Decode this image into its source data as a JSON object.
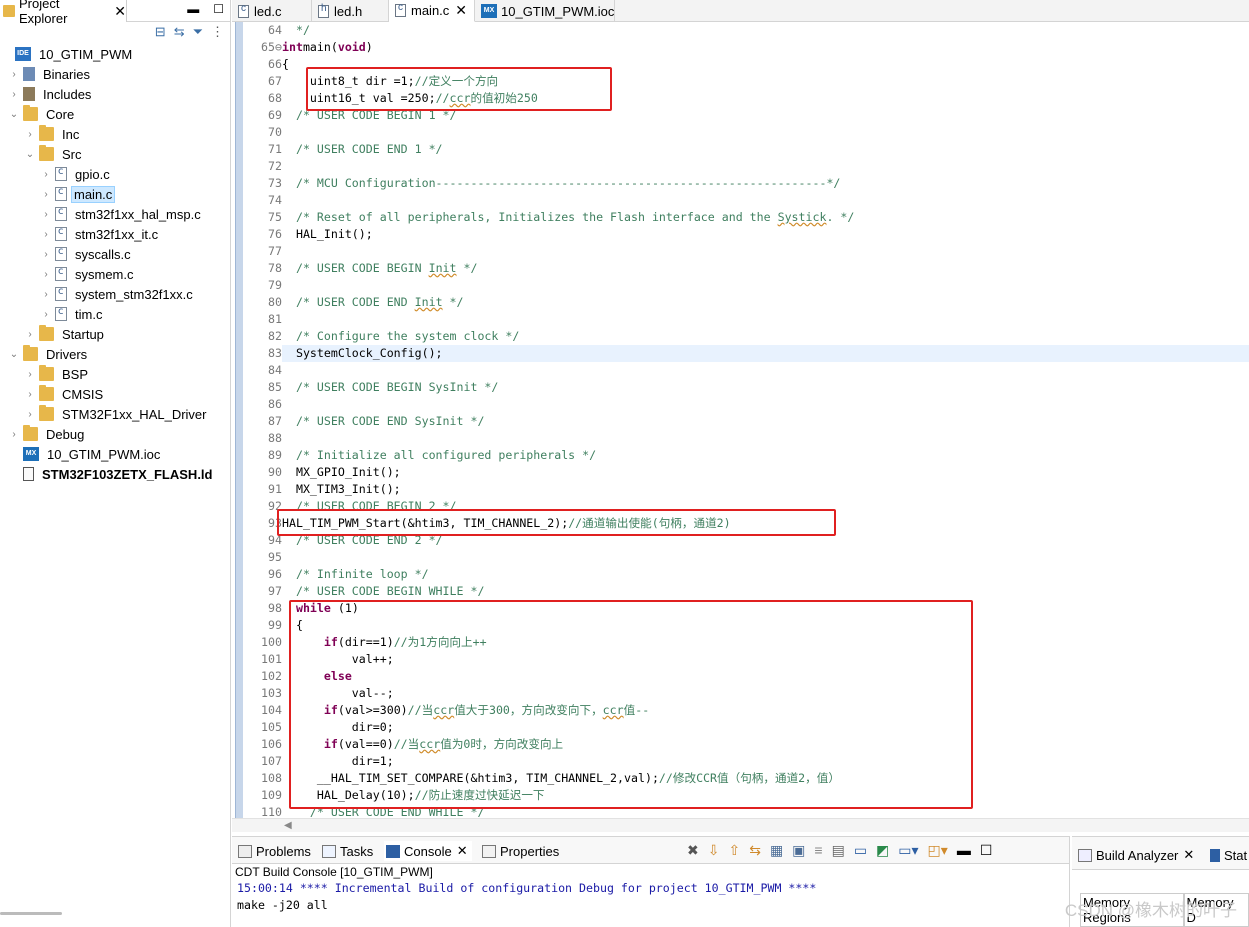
{
  "project_explorer": {
    "title": "Project Explorer",
    "items": [
      {
        "label": "10_GTIM_PWM",
        "icon": "project-icon",
        "chev": "",
        "level": 0
      },
      {
        "label": "Binaries",
        "icon": "binaries-icon",
        "chev": "›",
        "level": 1
      },
      {
        "label": "Includes",
        "icon": "includes-icon",
        "chev": "›",
        "level": 1
      },
      {
        "label": "Core",
        "icon": "folder-icon",
        "chev": "⌄",
        "level": 1
      },
      {
        "label": "Inc",
        "icon": "folder-icon",
        "chev": "›",
        "level": 2
      },
      {
        "label": "Src",
        "icon": "folder-icon",
        "chev": "⌄",
        "level": 2
      },
      {
        "label": "gpio.c",
        "icon": "c-file-icon",
        "chev": "›",
        "level": 3
      },
      {
        "label": "main.c",
        "icon": "c-file-icon",
        "chev": "›",
        "level": 3,
        "selected": true
      },
      {
        "label": "stm32f1xx_hal_msp.c",
        "icon": "c-file-icon",
        "chev": "›",
        "level": 3
      },
      {
        "label": "stm32f1xx_it.c",
        "icon": "c-file-icon",
        "chev": "›",
        "level": 3
      },
      {
        "label": "syscalls.c",
        "icon": "c-file-icon",
        "chev": "›",
        "level": 3
      },
      {
        "label": "sysmem.c",
        "icon": "c-file-icon",
        "chev": "›",
        "level": 3
      },
      {
        "label": "system_stm32f1xx.c",
        "icon": "c-file-icon",
        "chev": "›",
        "level": 3
      },
      {
        "label": "tim.c",
        "icon": "c-file-icon",
        "chev": "›",
        "level": 3
      },
      {
        "label": "Startup",
        "icon": "folder-icon",
        "chev": "›",
        "level": 2
      },
      {
        "label": "Drivers",
        "icon": "folder-icon",
        "chev": "⌄",
        "level": 1
      },
      {
        "label": "BSP",
        "icon": "folder-icon",
        "chev": "›",
        "level": 2
      },
      {
        "label": "CMSIS",
        "icon": "folder-icon",
        "chev": "›",
        "level": 2
      },
      {
        "label": "STM32F1xx_HAL_Driver",
        "icon": "folder-icon",
        "chev": "›",
        "level": 2
      },
      {
        "label": "Debug",
        "icon": "folder-icon",
        "chev": "›",
        "level": 1
      },
      {
        "label": "10_GTIM_PWM.ioc",
        "icon": "mx-file-icon",
        "chev": "",
        "level": 1
      },
      {
        "label": "STM32F103ZETX_FLASH.ld",
        "icon": "ld-file-icon",
        "chev": "",
        "level": 1,
        "bold": true
      }
    ]
  },
  "editor_tabs": [
    {
      "label": "led.c",
      "icon": "c-file-icon"
    },
    {
      "label": "led.h",
      "icon": "h-file-icon"
    },
    {
      "label": "main.c",
      "icon": "c-file-icon",
      "active": true,
      "close": "✕"
    },
    {
      "label": "10_GTIM_PWM.ioc",
      "icon": "mx-file-icon"
    }
  ],
  "code_lines": [
    {
      "n": "64",
      "seg": [
        [
          "cm",
          "  */"
        ]
      ]
    },
    {
      "n": "65⊖",
      "seg": [
        [
          "kw",
          "int"
        ],
        [
          "",
          "main"
        ],
        [
          "",
          "("
        ],
        [
          "kw",
          "void"
        ],
        [
          "",
          ")"
        ]
      ]
    },
    {
      "n": "66",
      "seg": [
        [
          "",
          "{"
        ]
      ]
    },
    {
      "n": "67",
      "seg": [
        [
          "",
          "    uint8_t dir =1;"
        ],
        [
          "cm",
          "//定义一个方向"
        ]
      ]
    },
    {
      "n": "68",
      "seg": [
        [
          "",
          "    uint16_t val =250;"
        ],
        [
          "cm",
          "//"
        ],
        [
          "cm sq",
          "ccr"
        ],
        [
          "cm",
          "的值初始250"
        ]
      ]
    },
    {
      "n": "69",
      "seg": [
        [
          "cm",
          "  /* USER CODE BEGIN 1 */"
        ]
      ]
    },
    {
      "n": "70",
      "seg": []
    },
    {
      "n": "71",
      "seg": [
        [
          "cm",
          "  /* USER CODE END 1 */"
        ]
      ]
    },
    {
      "n": "72",
      "seg": []
    },
    {
      "n": "73",
      "seg": [
        [
          "cm",
          "  /* MCU Configuration--------------------------------------------------------*/"
        ]
      ]
    },
    {
      "n": "74",
      "seg": []
    },
    {
      "n": "75",
      "seg": [
        [
          "cm",
          "  /* Reset of all peripherals, Initializes the Flash interface and the "
        ],
        [
          "cm sq",
          "Systick"
        ],
        [
          "cm",
          ". */"
        ]
      ]
    },
    {
      "n": "76",
      "seg": [
        [
          "",
          "  HAL_Init();"
        ]
      ]
    },
    {
      "n": "77",
      "seg": []
    },
    {
      "n": "78",
      "seg": [
        [
          "cm",
          "  /* USER CODE BEGIN "
        ],
        [
          "cm sq",
          "Init"
        ],
        [
          "cm",
          " */"
        ]
      ]
    },
    {
      "n": "79",
      "seg": []
    },
    {
      "n": "80",
      "seg": [
        [
          "cm",
          "  /* USER CODE END "
        ],
        [
          "cm sq",
          "Init"
        ],
        [
          "cm",
          " */"
        ]
      ]
    },
    {
      "n": "81",
      "seg": []
    },
    {
      "n": "82",
      "seg": [
        [
          "cm",
          "  /* Configure the system clock */"
        ]
      ]
    },
    {
      "n": "83",
      "seg": [
        [
          "",
          "  SystemClock_Config();"
        ]
      ],
      "current": true
    },
    {
      "n": "84",
      "seg": []
    },
    {
      "n": "85",
      "seg": [
        [
          "cm",
          "  /* USER CODE BEGIN SysInit */"
        ]
      ]
    },
    {
      "n": "86",
      "seg": []
    },
    {
      "n": "87",
      "seg": [
        [
          "cm",
          "  /* USER CODE END SysInit */"
        ]
      ]
    },
    {
      "n": "88",
      "seg": []
    },
    {
      "n": "89",
      "seg": [
        [
          "cm",
          "  /* Initialize all configured peripherals */"
        ]
      ]
    },
    {
      "n": "90",
      "seg": [
        [
          "",
          "  MX_GPIO_Init();"
        ]
      ]
    },
    {
      "n": "91",
      "seg": [
        [
          "",
          "  MX_TIM3_Init();"
        ]
      ]
    },
    {
      "n": "92",
      "seg": [
        [
          "cm",
          "  /* USER CODE BEGIN 2 */"
        ]
      ]
    },
    {
      "n": "93",
      "seg": [
        [
          "",
          "HAL_TIM_PWM_Start(&htim3, TIM_CHANNEL_2);"
        ],
        [
          "cm",
          "//通道输出使能(句柄，通道2)"
        ]
      ]
    },
    {
      "n": "94",
      "seg": [
        [
          "cm",
          "  /* USER CODE END 2 */"
        ]
      ]
    },
    {
      "n": "95",
      "seg": []
    },
    {
      "n": "96",
      "seg": [
        [
          "cm",
          "  /* Infinite loop */"
        ]
      ]
    },
    {
      "n": "97",
      "seg": [
        [
          "cm",
          "  /* USER CODE BEGIN WHILE */"
        ]
      ]
    },
    {
      "n": "98",
      "seg": [
        [
          "",
          "  "
        ],
        [
          "kw",
          "while"
        ],
        [
          "",
          " (1)"
        ]
      ]
    },
    {
      "n": "99",
      "seg": [
        [
          "",
          "  {"
        ]
      ]
    },
    {
      "n": "100",
      "seg": [
        [
          "",
          "      "
        ],
        [
          "kw",
          "if"
        ],
        [
          "",
          "(dir==1)"
        ],
        [
          "cm",
          "//为1方向向上++"
        ]
      ]
    },
    {
      "n": "101",
      "seg": [
        [
          "",
          "          val++;"
        ]
      ]
    },
    {
      "n": "102",
      "seg": [
        [
          "",
          "      "
        ],
        [
          "kw",
          "else"
        ]
      ]
    },
    {
      "n": "103",
      "seg": [
        [
          "",
          "          val--;"
        ]
      ]
    },
    {
      "n": "104",
      "seg": [
        [
          "",
          "      "
        ],
        [
          "kw",
          "if"
        ],
        [
          "",
          "(val>=300)"
        ],
        [
          "cm",
          "//当"
        ],
        [
          "cm sq",
          "ccr"
        ],
        [
          "cm",
          "值大于300，方向改变向下，"
        ],
        [
          "cm sq",
          "ccr"
        ],
        [
          "cm",
          "值--"
        ]
      ]
    },
    {
      "n": "105",
      "seg": [
        [
          "",
          "          dir=0;"
        ]
      ]
    },
    {
      "n": "106",
      "seg": [
        [
          "",
          "      "
        ],
        [
          "kw",
          "if"
        ],
        [
          "",
          "(val==0)"
        ],
        [
          "cm",
          "//当"
        ],
        [
          "cm sq",
          "ccr"
        ],
        [
          "cm",
          "值为0时，方向改变向上"
        ]
      ]
    },
    {
      "n": "107",
      "seg": [
        [
          "",
          "          dir=1;"
        ]
      ]
    },
    {
      "n": "108",
      "seg": [
        [
          "",
          "     __HAL_TIM_SET_COMPARE(&htim3, TIM_CHANNEL_2,val);"
        ],
        [
          "cm",
          "//修改CCR值（句柄，通道2，值）"
        ]
      ]
    },
    {
      "n": "109",
      "seg": [
        [
          "",
          "     HAL_Delay(10);"
        ],
        [
          "cm",
          "//防止速度过快延迟一下"
        ]
      ]
    },
    {
      "n": "110",
      "seg": [
        [
          "cm",
          "    /* USER CODE END WHILE */"
        ]
      ]
    }
  ],
  "bottom_panel": {
    "tabs": [
      "Problems",
      "Tasks",
      "Console",
      "Properties"
    ],
    "console_title": "CDT Build Console [10_GTIM_PWM]",
    "console_lines": [
      "15:00:14 **** Incremental Build of configuration Debug for project 10_GTIM_PWM ****",
      "make -j20 all"
    ]
  },
  "build_analyzer": {
    "tab": "Build Analyzer",
    "tab2": "Stat",
    "subtabs": [
      "Memory Regions",
      "Memory D"
    ]
  },
  "watermark": "CSDN @橡木树的叶子",
  "colors": {
    "highlight_box": "#e02020",
    "keyword": "#7f0055",
    "comment": "#3f7f5f",
    "console_info": "#1a1aa6",
    "selection": "#cde8ff"
  }
}
